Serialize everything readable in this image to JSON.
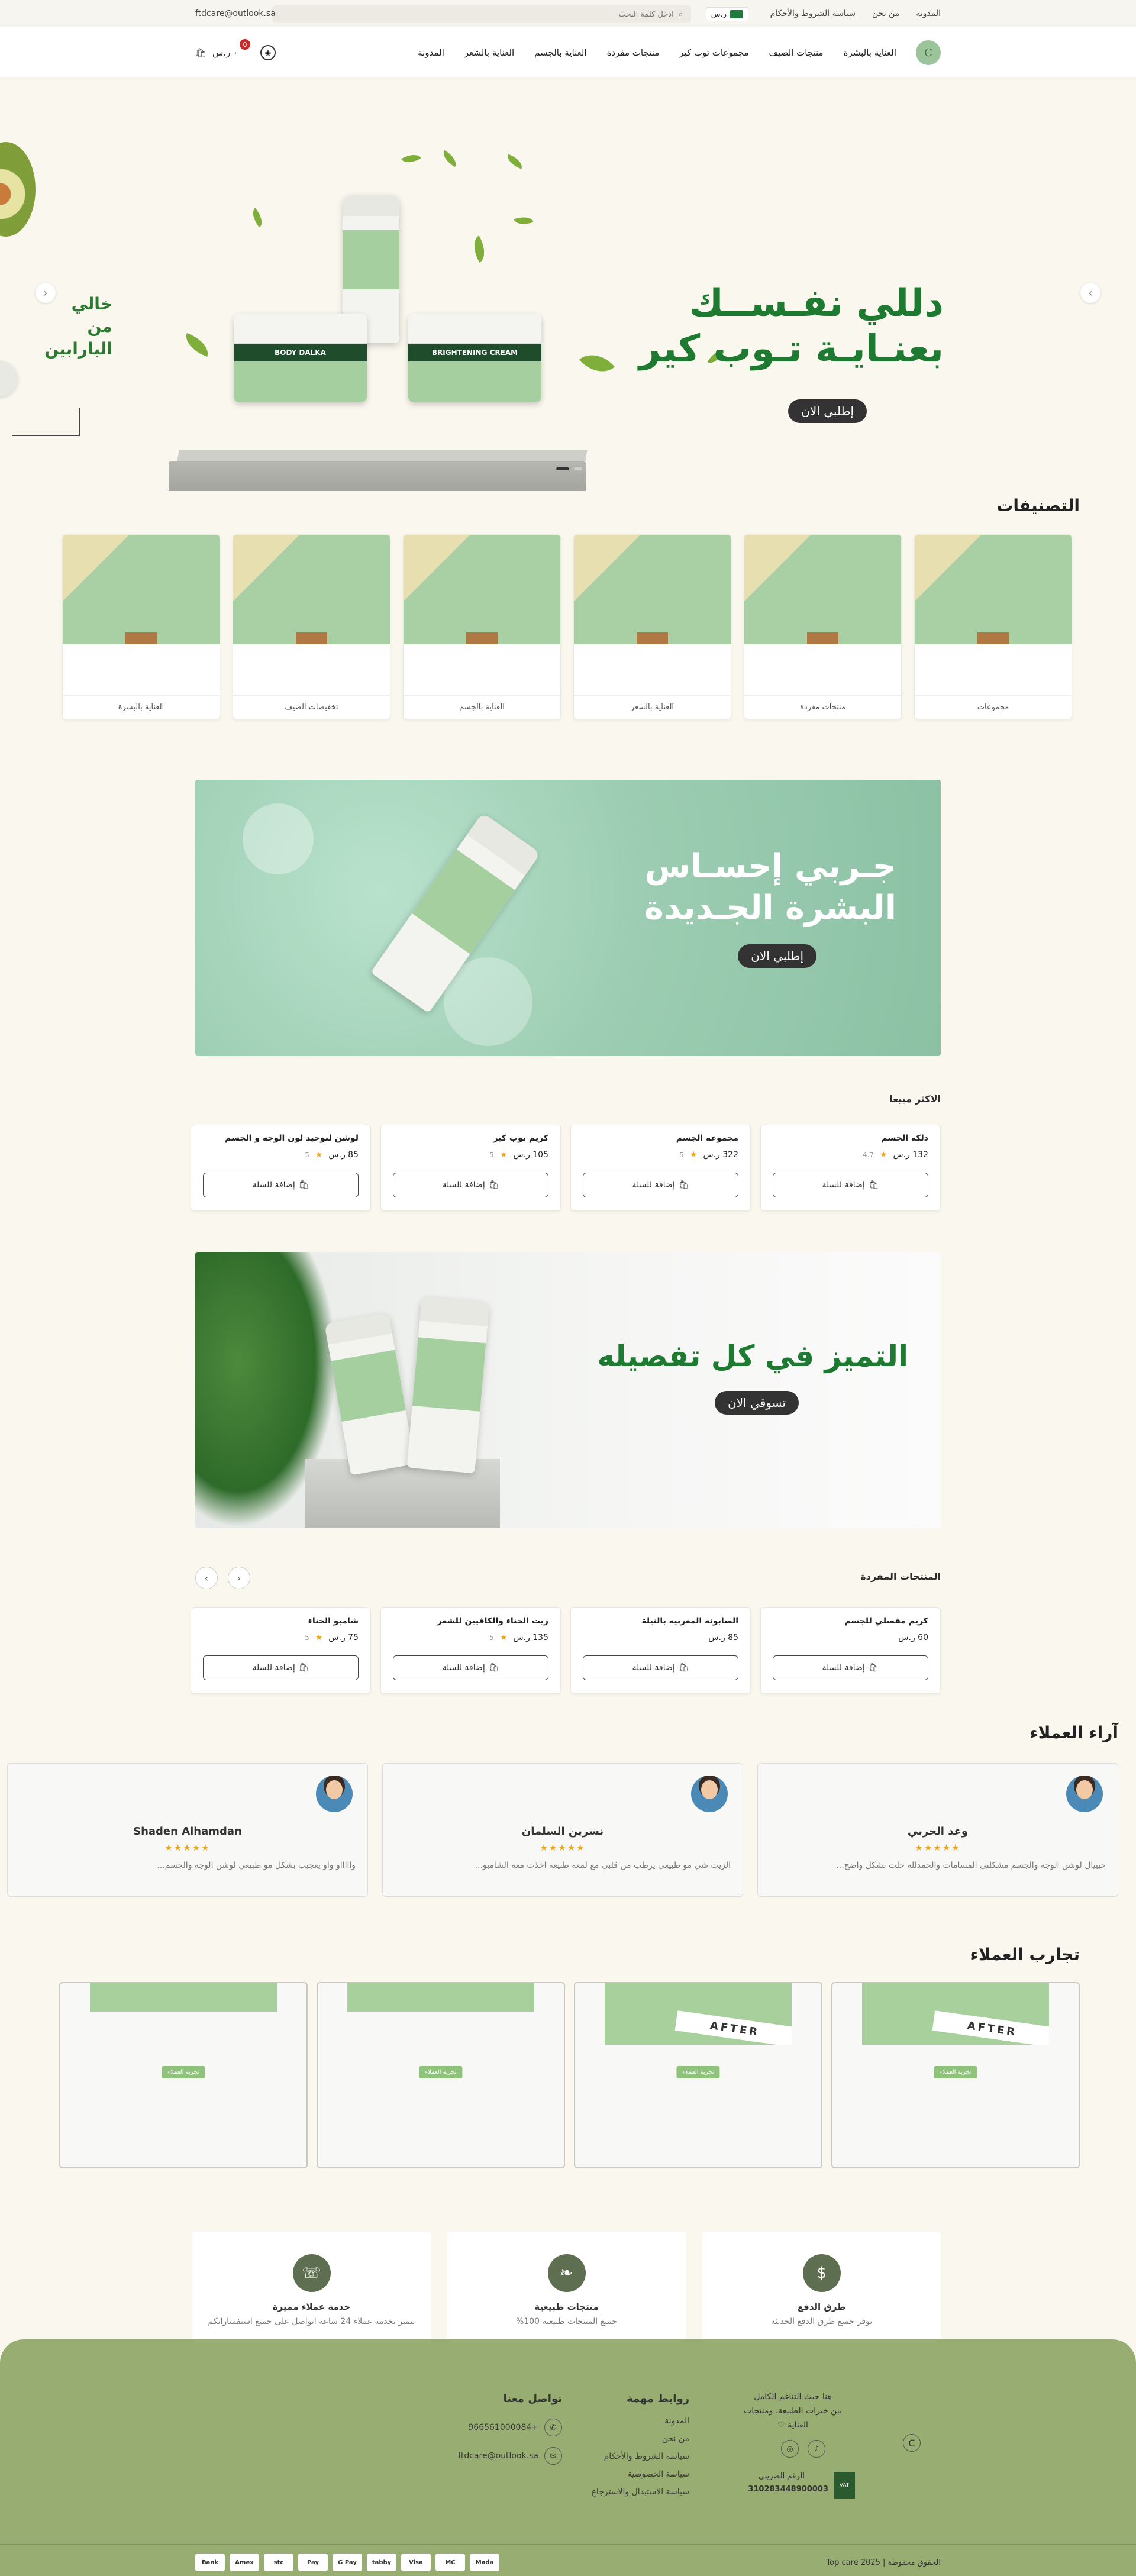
{
  "topbar": {
    "links": [
      "المدونة",
      "من نحن",
      "سياسة الشروط والأحكام"
    ],
    "currency": "ر.س",
    "search_placeholder": "ادخل كلمة البحث",
    "email": "ftdcare@outlook.sa"
  },
  "nav": {
    "logo_text": "C",
    "menu": [
      "العناية بالبشرة",
      "منتجات الصيف",
      "مجموعات توب كير",
      "منتجات مفردة",
      "العناية بالجسم",
      "العناية بالشعر",
      "المدونة"
    ],
    "cart_total": "٠ ر.س",
    "cart_count": "0"
  },
  "hero": {
    "side_text": "خالي من البارابين",
    "title_line1": "دللي نفـســك",
    "title_line2": "بعنـايـة تـوب كير",
    "button": "إطلبي الان",
    "jar_left": "BODY DALKA",
    "jar_right": "BRIGHTENING CREAM",
    "slides": 2,
    "active_slide": 2
  },
  "categories": {
    "title": "التصنيفات",
    "items": [
      "مجموعات",
      "منتجات مفردة",
      "العناية بالشعر",
      "العناية بالجسم",
      "تخفيضات الصيف",
      "العناية بالبشرة"
    ]
  },
  "banner1": {
    "line1": "جـربي إحسـاس",
    "line2": "البشرة الجـديدة",
    "button": "إطلبي الان"
  },
  "bestsellers": {
    "title": "الاكثر مبيعا",
    "add_label": "إضافة للسلة",
    "items": [
      {
        "name": "دلكة الجسم",
        "price": "132 ر.س",
        "rating": "4.7"
      },
      {
        "name": "مجموعة الجسم",
        "price": "322 ر.س",
        "rating": "5"
      },
      {
        "name": "كريم توب كير",
        "price": "105 ر.س",
        "rating": "5"
      },
      {
        "name": "لوشن لتوحيد لون الوجه و الجسم",
        "price": "85 ر.س",
        "rating": "5"
      }
    ]
  },
  "banner2": {
    "title": "التميز في كل تفصيله",
    "button": "تسوقي الان"
  },
  "singles": {
    "title": "المنتجات المفردة",
    "add_label": "إضافة للسلة",
    "items": [
      {
        "name": "كريم مفصلي للجسم",
        "price": "60 ر.س",
        "rating": ""
      },
      {
        "name": "الصابونه المغربيه بالنيلة",
        "price": "85 ر.س",
        "rating": ""
      },
      {
        "name": "زيت الحناء والكافيين للشعر",
        "price": "135 ر.س",
        "rating": "5"
      },
      {
        "name": "شامبو الحناء",
        "price": "75 ر.س",
        "rating": "5"
      }
    ]
  },
  "reviews": {
    "title": "آراء العملاء",
    "stars": "★★★★★",
    "items": [
      {
        "name": "وعد الحربي",
        "text": "خيييال لوشن الوجه والجسم مشكلتي المسامات والحمدلله خلت بشكل واضح..."
      },
      {
        "name": "نسرين السلمان",
        "text": "الزيت شي مو طبيعي يرطب من قلبي مع لمعة طبيعة اخذت معه الشامبو..."
      },
      {
        "name": "Shaden Alhamdan",
        "text": "واااااو واو يعجبب بشكل مو طبيعي لوشن الوجه والجسم..."
      }
    ]
  },
  "experiences": {
    "title": "تجارب العملاء",
    "button": "تجربة العملاء",
    "after": "AFTER"
  },
  "features": [
    {
      "title": "طرق الدفع",
      "sub": "توفر جميع طرق الدفع الحديثه",
      "icon": "money-bag-icon",
      "glyph": "$"
    },
    {
      "title": "منتجات طبيعية",
      "sub": "جميع المنتجات طبيعية 100%",
      "icon": "leaf-icon",
      "glyph": "❧"
    },
    {
      "title": "خدمة عملاء مميزة",
      "sub": "تتميز بخدمة عملاء 24 ساعة اتواصل على جميع استفساراتكم",
      "icon": "headset-icon",
      "glyph": "☏"
    }
  ],
  "footer": {
    "about_line1": "هنا حيث التناغم الكامل",
    "about_line2": "بين خيرات الطبيعة، ومنتجات",
    "about_line3": "العناية ♡",
    "vat_label": "الرقم الضريبي",
    "vat_number": "310283448900003",
    "links_title": "روابط مهمة",
    "links": [
      "المدونة",
      "من نحن",
      "سياسة الشروط والأحكام",
      "سياسة الخصوصية",
      "سياسة الاستبدال والاسترجاع"
    ],
    "contact_title": "تواصل معنا",
    "phone": "+966561000084",
    "email": "ftdcare@outlook.sa",
    "copyright": "الحقوق محفوظة | 2025 Top care",
    "payments": [
      "Mada",
      "MC",
      "Visa",
      "tabby",
      "G Pay",
      "Pay",
      "stc",
      "Amex",
      "Bank"
    ]
  }
}
